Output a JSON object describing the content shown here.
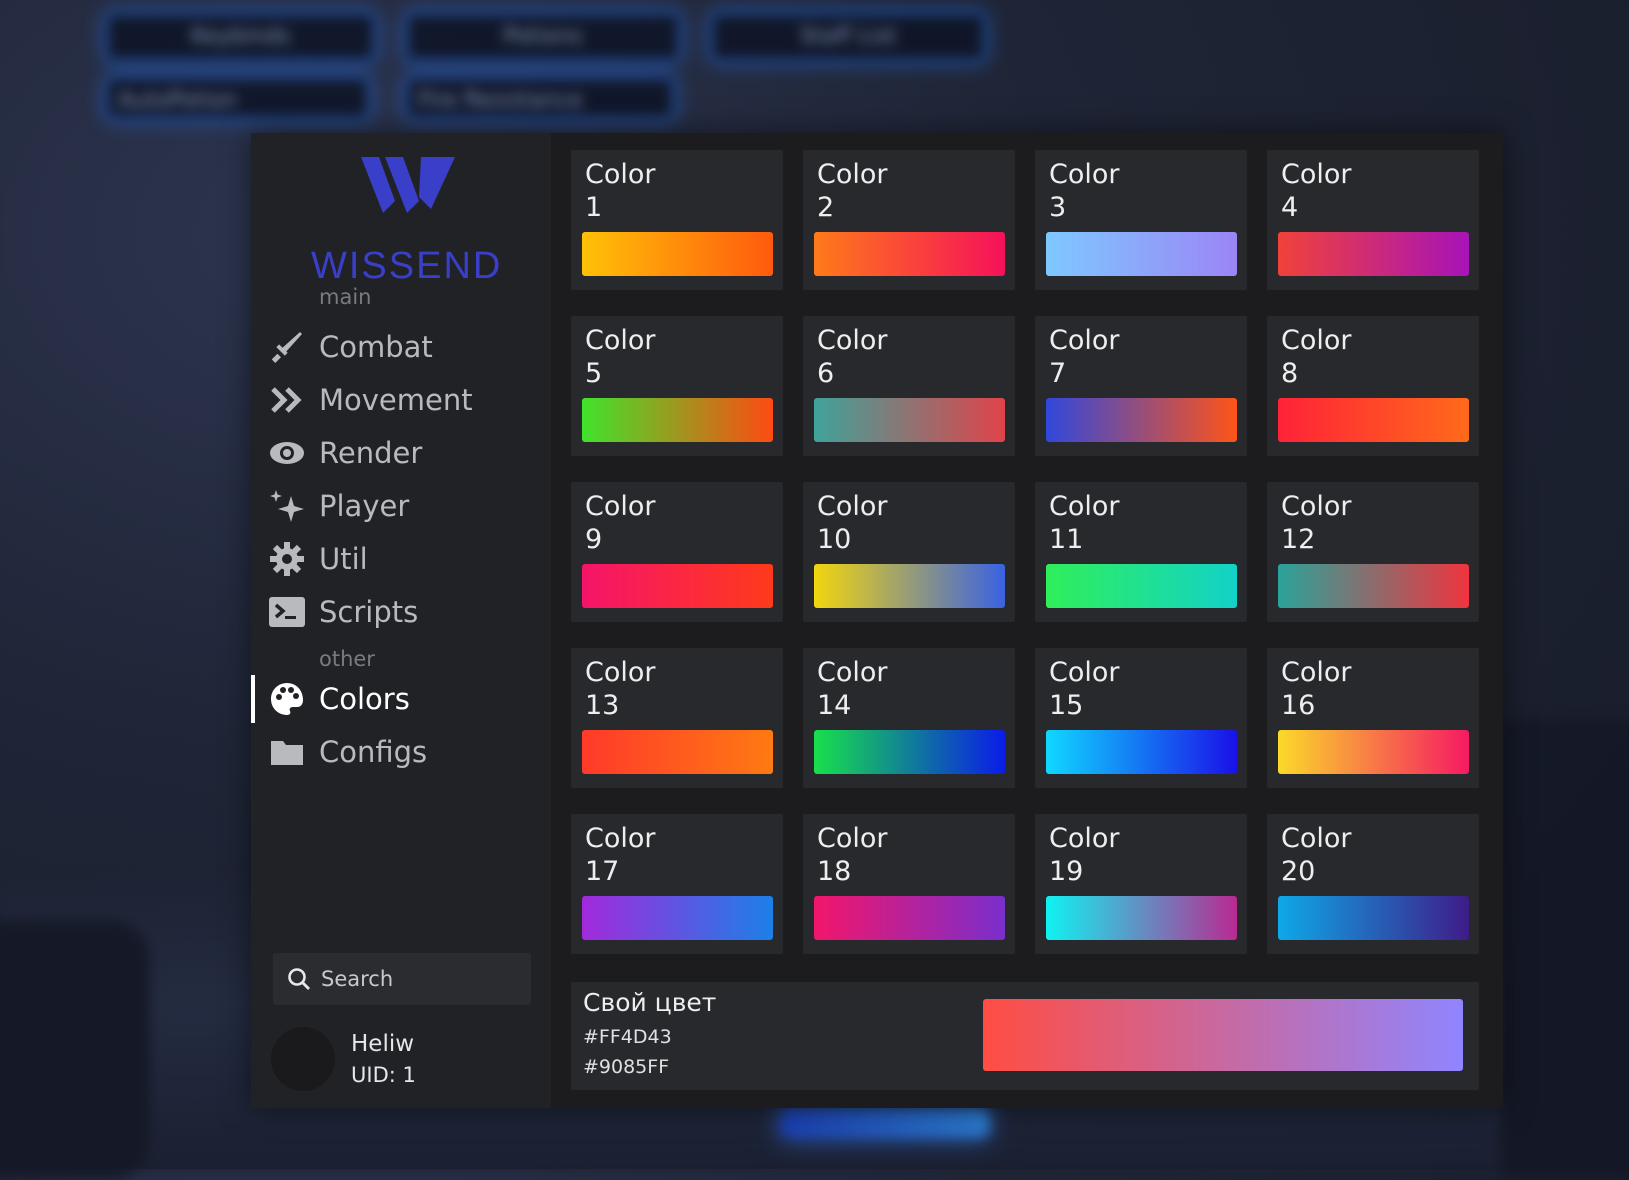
{
  "background": {
    "pills": [
      "Keybinds",
      "Potions",
      "Staff List",
      "AutoPotion",
      "Fire Resistance"
    ]
  },
  "sidebar": {
    "logo_text": "WISSEND",
    "section_main": "main",
    "section_other": "other",
    "items": [
      {
        "label": "Combat",
        "icon": "sword-icon"
      },
      {
        "label": "Movement",
        "icon": "double-chevron-icon"
      },
      {
        "label": "Render",
        "icon": "eye-icon"
      },
      {
        "label": "Player",
        "icon": "sparkles-icon"
      },
      {
        "label": "Util",
        "icon": "gear-icon"
      },
      {
        "label": "Scripts",
        "icon": "terminal-icon"
      },
      {
        "label": "Colors",
        "icon": "palette-icon",
        "active": true
      },
      {
        "label": "Configs",
        "icon": "folder-icon"
      }
    ],
    "search_label": "Search",
    "user": {
      "name": "Heliw",
      "uid": "UID: 1"
    }
  },
  "colors": [
    {
      "label": "Color",
      "num": "1",
      "from": "#FFC107",
      "to": "#FF5A0E"
    },
    {
      "label": "Color",
      "num": "2",
      "from": "#FF7A1A",
      "to": "#F5115A"
    },
    {
      "label": "Color",
      "num": "3",
      "from": "#7EC8FF",
      "to": "#9B85F5"
    },
    {
      "label": "Color",
      "num": "4",
      "from": "#F0423A",
      "to": "#A713B8"
    },
    {
      "label": "Color",
      "num": "5",
      "from": "#3FE32C",
      "to": "#FF4A12"
    },
    {
      "label": "Color",
      "num": "6",
      "from": "#3FA39A",
      "to": "#E0434A"
    },
    {
      "label": "Color",
      "num": "7",
      "from": "#3048DC",
      "to": "#FF5418"
    },
    {
      "label": "Color",
      "num": "8",
      "from": "#FF2238",
      "to": "#FF6A1A"
    },
    {
      "label": "Color",
      "num": "9",
      "from": "#F5146A",
      "to": "#FF3A1A"
    },
    {
      "label": "Color",
      "num": "10",
      "from": "#F2D60E",
      "to": "#3A62E2"
    },
    {
      "label": "Color",
      "num": "11",
      "from": "#2FEF5A",
      "to": "#12D2C8"
    },
    {
      "label": "Color",
      "num": "12",
      "from": "#2AA39A",
      "to": "#F0343E"
    },
    {
      "label": "Color",
      "num": "13",
      "from": "#FF3A2A",
      "to": "#FF7A12"
    },
    {
      "label": "Color",
      "num": "14",
      "from": "#18E04A",
      "to": "#0A1CE8"
    },
    {
      "label": "Color",
      "num": "15",
      "from": "#10D8FF",
      "to": "#1A10E8"
    },
    {
      "label": "Color",
      "num": "16",
      "from": "#FAD92A",
      "to": "#F51A62"
    },
    {
      "label": "Color",
      "num": "17",
      "from": "#A22ADC",
      "to": "#1C80E8"
    },
    {
      "label": "Color",
      "num": "18",
      "from": "#F2166A",
      "to": "#7A2ECC"
    },
    {
      "label": "Color",
      "num": "19",
      "from": "#10F2F2",
      "to": "#B82A92"
    },
    {
      "label": "Color",
      "num": "20",
      "from": "#0EA8E8",
      "to": "#3E1C88"
    }
  ],
  "custom_color": {
    "title": "Свой цвет",
    "hex1": "#FF4D43",
    "hex2": "#9085FF"
  }
}
